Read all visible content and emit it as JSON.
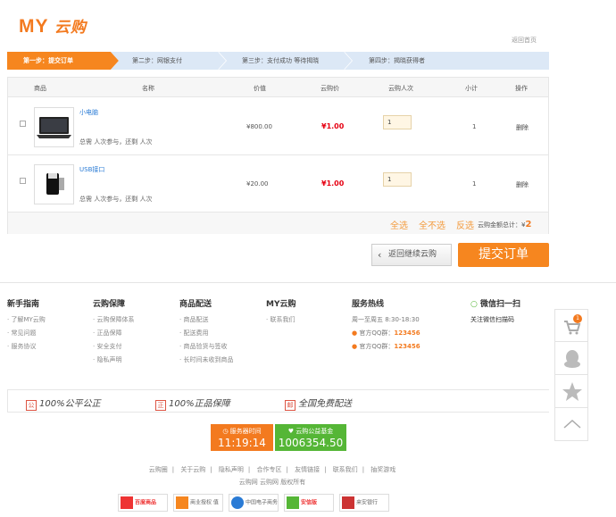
{
  "header": {
    "logo_en": "MY",
    "logo_cn": "云购",
    "home_link": "返回首页"
  },
  "steps": [
    {
      "label": "第一步：提交订单"
    },
    {
      "label": "第二步：网银支付"
    },
    {
      "label": "第三步：支付成功 等待揭晓"
    },
    {
      "label": "第四步：揭晓获得者"
    }
  ],
  "colors": {
    "accent": "#f37a1f",
    "step_active": "#f6861f",
    "step_inactive": "#dce8f6",
    "price_red": "#e60012",
    "link_blue": "#2a7bd5",
    "fund_green": "#55b636"
  },
  "table": {
    "headers": [
      "商品",
      "名称",
      "价值",
      "云购价",
      "云购人次",
      "小计",
      "操作"
    ],
    "rows": [
      {
        "name": "小电脑",
        "info": "总需 人次参与，还剩 人次",
        "price": "¥800.00",
        "yprice": "¥1.00",
        "qty": "1",
        "subtotal": "1",
        "action": "删除",
        "thumb_icon": "laptop-icon"
      },
      {
        "name": "USB接口",
        "info": "总需 人次参与，还剩 人次",
        "price": "¥20.00",
        "yprice": "¥1.00",
        "qty": "1",
        "subtotal": "1",
        "action": "删除",
        "thumb_icon": "usb-adapter-icon"
      }
    ],
    "footer": {
      "select_all": "全选",
      "select_none": "全不选",
      "invert": "反选",
      "total_label": "云购金额总计：¥",
      "total_value": "2"
    }
  },
  "actions": {
    "back_label": "返回继续云购",
    "submit_label": "提交订单"
  },
  "footer_cols": [
    {
      "title": "新手指南",
      "items": [
        "了解MY云购",
        "常见问题",
        "服务协议"
      ]
    },
    {
      "title": "云购保障",
      "items": [
        "云购保障体系",
        "正品保障",
        "安全支付",
        "隐私声明"
      ]
    },
    {
      "title": "商品配送",
      "items": [
        "商品配送",
        "配送费用",
        "商品验货与签收",
        "长时间未收到商品"
      ]
    },
    {
      "title": "MY云购",
      "items": [
        "联系我们"
      ]
    },
    {
      "title": "服务热线",
      "items": [
        "周一至周五 8:30-18:30"
      ],
      "qq": [
        {
          "label": "官方QQ群：",
          "value": "123456"
        },
        {
          "label": "官方QQ群：",
          "value": "123456"
        }
      ]
    },
    {
      "title": "微信扫一扫",
      "items": [
        "关注微信扫描码"
      ]
    }
  ],
  "sidebar": {
    "cart_badge": "1"
  },
  "promise": [
    "100%公平公正",
    "100%正品保障",
    "全国免费配送"
  ],
  "promise_icons": [
    "公",
    "正",
    "邮"
  ],
  "timer": {
    "label": "服务器时间",
    "value": "11:19:14"
  },
  "fund": {
    "label": "云购公益基金",
    "value": "1006354.50"
  },
  "footer_links": [
    "云购圈",
    "关于云购",
    "隐私声明",
    "合作专区",
    "友情链接",
    "联系我们",
    "抽奖游戏"
  ],
  "copyright": "云购网 云购网 版权所有",
  "badges": [
    "百度商品",
    "商业授权 值得信赖",
    "中国电子商务 诚信单位",
    "安信版",
    "来安银行"
  ]
}
